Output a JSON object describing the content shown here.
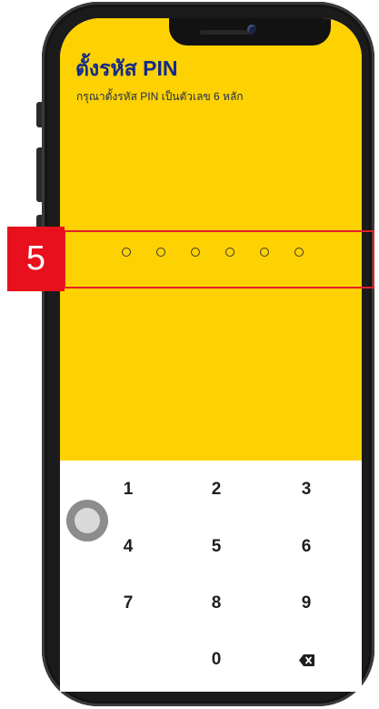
{
  "annotation": {
    "step_number": "5"
  },
  "pin_setup": {
    "title": "ตั้งรหัส PIN",
    "subtitle": "กรุณาตั้งรหัส PIN เป็นตัวเลข 6 หลัก",
    "pin_length": 6,
    "digits_entered": 0
  },
  "keypad": {
    "keys": [
      "1",
      "2",
      "3",
      "4",
      "5",
      "6",
      "7",
      "8",
      "9",
      "",
      "0",
      "backspace"
    ]
  },
  "colors": {
    "accent_yellow": "#fed102",
    "title_blue": "#122a8c",
    "annotation_red": "#e3202b"
  },
  "icons": {
    "backspace": "backspace-icon",
    "assistive_touch": "assistive-touch-icon"
  }
}
